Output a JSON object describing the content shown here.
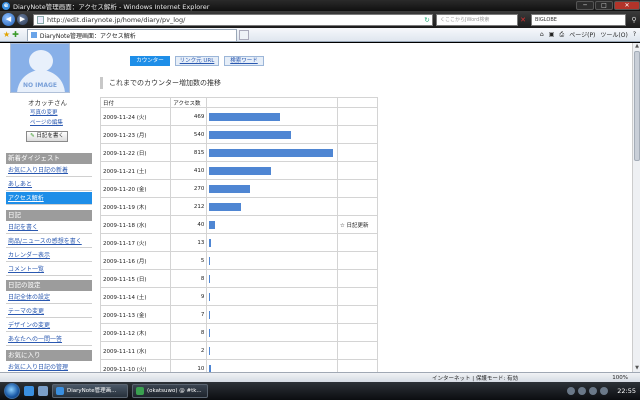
{
  "window": {
    "title": "DiaryNote管理画面：アクセス解析 - Windows Internet Explorer",
    "minimize": "─",
    "maximize": "□",
    "close": "✕"
  },
  "address": {
    "url": "http://edit.diarynote.jp/home/diary/pv_log/",
    "search_hint": "くここからJWord検索",
    "search_engine": "BIGLOBE"
  },
  "tab": {
    "label": "DiaryNote管理画面：アクセス解析"
  },
  "commands": {
    "home": "⌂",
    "feeds": "▣",
    "print": "⎙",
    "page": "ページ(P)",
    "tools": "ツール(O)",
    "help": "?"
  },
  "sidebar": {
    "noimage": "NO IMAGE",
    "username": "オカッチさん",
    "links": [
      "写真の変更",
      "ページの編集"
    ],
    "write_button": "日記を書く",
    "sections": [
      {
        "title": "新着ダイジェスト",
        "items": [
          "お気に入り日記の新着",
          "あしあと",
          "アクセス解析"
        ]
      },
      {
        "title": "日記",
        "items": [
          "日記を書く",
          "商品/ニュースの感想を書く",
          "カレンダー表示",
          "コメント一覧"
        ]
      },
      {
        "title": "日記の設定",
        "items": [
          "日記全体の設定",
          "テーマの変更",
          "デザインの変更",
          "あなたへの一問一答"
        ]
      },
      {
        "title": "お気に入り",
        "items": [
          "お気に入り日記の管理"
        ]
      }
    ]
  },
  "main": {
    "tabs": [
      "カウンター",
      "リンク元 URL",
      "検索ワード"
    ],
    "heading": "これまでのカウンター増加数の推移",
    "col_date": "日付",
    "col_count": "アクセス数"
  },
  "chart_data": {
    "type": "bar",
    "categories": [
      "2009-11-24 (火)",
      "2009-11-23 (月)",
      "2009-11-22 (日)",
      "2009-11-21 (土)",
      "2009-11-20 (金)",
      "2009-11-19 (木)",
      "2009-11-18 (水)",
      "2009-11-17 (火)",
      "2009-11-16 (月)",
      "2009-11-15 (日)",
      "2009-11-14 (土)",
      "2009-11-13 (金)",
      "2009-11-12 (木)",
      "2009-11-11 (水)",
      "2009-11-10 (火)"
    ],
    "values": [
      469,
      540,
      815,
      410,
      270,
      212,
      40,
      13,
      5,
      8,
      9,
      7,
      8,
      2,
      10
    ],
    "notes": [
      "",
      "",
      "",
      "",
      "",
      "",
      "☆ 日記更新",
      "",
      "",
      "",
      "",
      "",
      "",
      "",
      ""
    ],
    "max": 815,
    "bar_color": "#4f86d3"
  },
  "statusbar": {
    "zone": "インターネット | 保護モード: 有効",
    "zoom": "100%"
  },
  "taskbar": {
    "items": [
      "DiaryNote管理画...",
      "(okatsuwo) @ #tk..."
    ],
    "clock": "22:55"
  }
}
